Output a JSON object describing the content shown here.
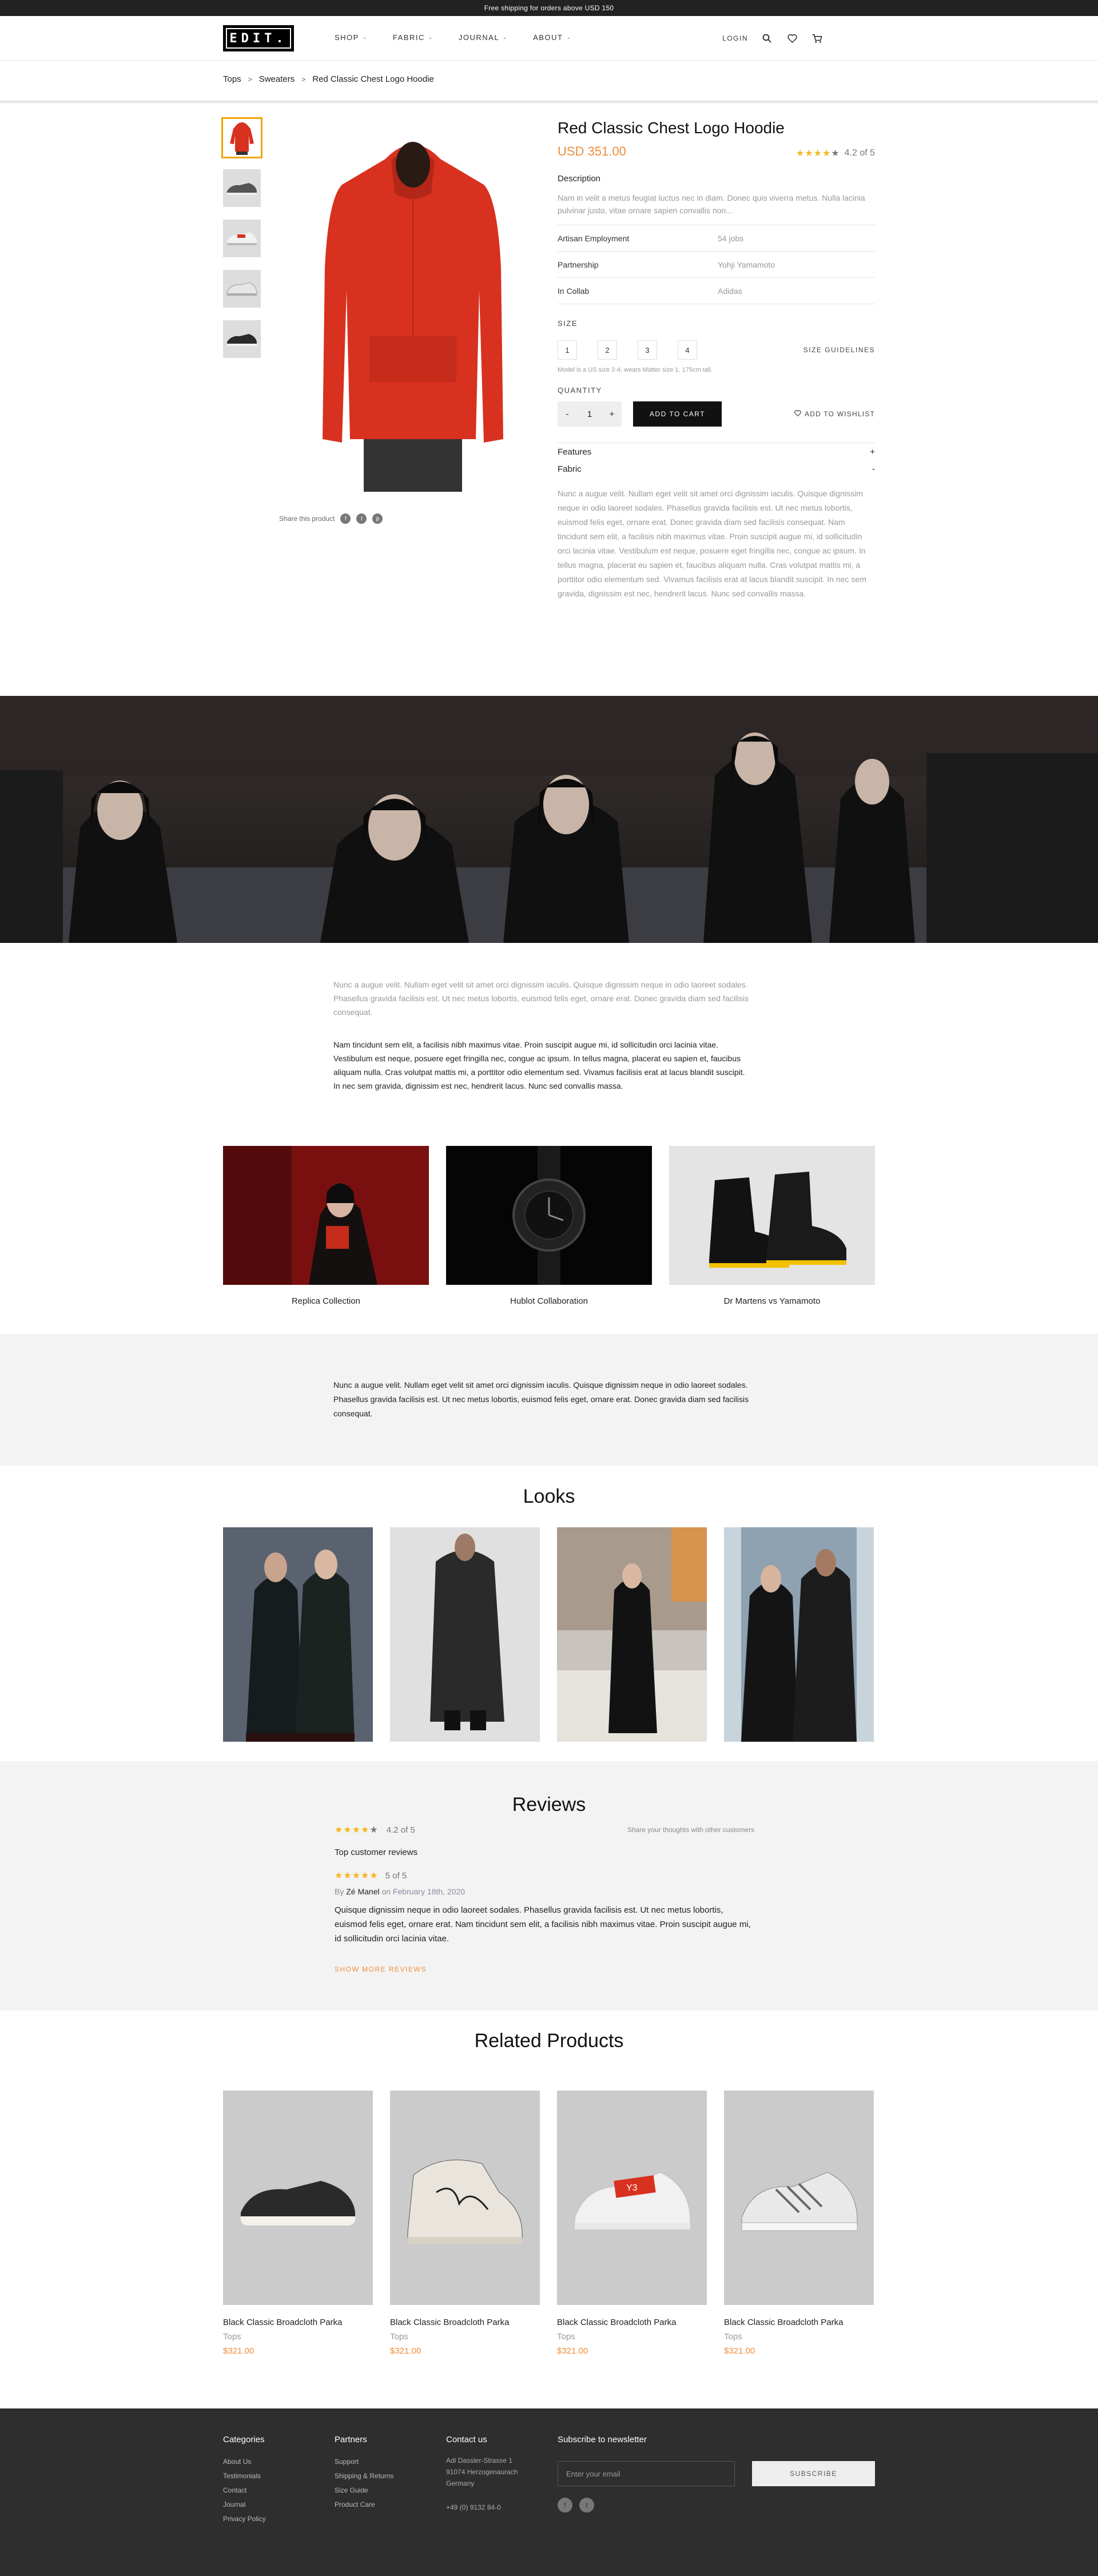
{
  "topbar": {
    "text": "Free shipping for orders above USD 150"
  },
  "header": {
    "logo": "EDIT.",
    "nav": [
      {
        "label": "SHOP"
      },
      {
        "label": "FABRIC"
      },
      {
        "label": "JOURNAL"
      },
      {
        "label": "ABOUT"
      }
    ],
    "login": "LOGIN",
    "icons": [
      "search-icon",
      "heart-icon",
      "cart-icon"
    ]
  },
  "breadcrumb": [
    "Tops",
    "Sweaters",
    "Red Classic Chest Logo Hoodie"
  ],
  "product": {
    "title": "Red Classic Chest Logo Hoodie",
    "price": "USD 351.00",
    "rating": 4.2,
    "rating_text": "4.2 of 5",
    "description_heading": "Description",
    "description": "Nam in velit a metus feugiat luctus nec in diam. Donec quis viverra metus. Nulla lacinia pulvinar justo, vitae ornare sapien convallis non...",
    "attributes": [
      {
        "key": "Artisan Employment",
        "value": "54 jobs"
      },
      {
        "key": "Partnership",
        "value": "Yohji Yamamoto"
      },
      {
        "key": "In Collab",
        "value": "Adidas"
      }
    ],
    "size_heading": "SIZE",
    "sizes": [
      "1",
      "2",
      "3",
      "4"
    ],
    "size_guide": "SIZE GUIDELINES",
    "model_note": "Model is a US size 2-4, wears Matter size 1. 175cm tall.",
    "quantity_heading": "QUANTITY",
    "quantity": "1",
    "minus": "-",
    "plus": "+",
    "add_to_cart": "ADD TO CART",
    "wishlist": "ADD TO WISHLIST",
    "accordion": [
      {
        "label": "Features",
        "sign": "+"
      },
      {
        "label": "Fabric",
        "sign": "-"
      }
    ],
    "fabric_text": "Nunc a augue velit. Nullam eget velit sit amet orci dignissim iaculis. Quisque dignissim neque in odio laoreet sodales. Phasellus gravida facilisis est. Ut nec metus lobortis, euismod felis eget, ornare erat. Donec gravida diam sed facilisis consequat. Nam tincidunt sem elit, a facilisis nibh maximus vitae. Proin suscipit augue mi, id sollicitudin orci lacinia vitae. Vestibulum est neque, posuere eget fringilla nec, congue ac ipsum. In tellus magna, placerat eu sapien et, faucibus aliquam nulla. Cras volutpat mattis mi, a porttitor odio elementum sed. Vivamus facilisis erat at lacus blandit suscipit. In nec sem gravida, dignissim est nec, hendrerit lacus. Nunc sed convallis massa.",
    "share_label": "Share this product",
    "share_icons": [
      "facebook-icon",
      "twitter-icon",
      "pinterest-icon"
    ]
  },
  "story": {
    "p1": "Nunc a augue velit. Nullam eget velit sit amet orci dignissim iaculis. Quisque dignissim neque in odio laoreet sodales. Phasellus gravida facilisis est. Ut nec metus lobortis, euismod felis eget, ornare erat. Donec gravida diam sed facilisis consequat.",
    "p2": "Nam tincidunt sem elit, a facilisis nibh maximus vitae. Proin suscipit augue mi, id sollicitudin orci lacinia vitae. Vestibulum est neque, posuere eget fringilla nec, congue ac ipsum. In tellus magna, placerat eu sapien et, faucibus aliquam nulla. Cras volutpat mattis mi, a porttitor odio elementum sed. Vivamus facilisis erat at lacus blandit suscipit. In nec sem gravida, dignissim est nec, hendrerit lacus. Nunc sed convallis massa."
  },
  "collections": [
    {
      "label": "Replica Collection"
    },
    {
      "label": "Hublot Collaboration"
    },
    {
      "label": "Dr Martens vs Yamamoto"
    }
  ],
  "grey_text": "Nunc a augue velit. Nullam eget velit sit amet orci dignissim iaculis. Quisque dignissim neque in odio laoreet sodales. Phasellus gravida facilisis est. Ut nec metus lobortis, euismod felis eget, ornare erat. Donec gravida diam sed facilisis consequat.",
  "looks": {
    "title": "Looks"
  },
  "reviews": {
    "title": "Reviews",
    "summary": "4.2 of 5",
    "share": "Share your thoughts with other customers",
    "top": "Top customer reviews",
    "item": {
      "rating_text": "5 of 5",
      "by": "By",
      "author": "Zé Manel",
      "on": "on",
      "date": "February 18th, 2020",
      "text": "Quisque dignissim neque in odio laoreet sodales. Phasellus gravida facilisis est. Ut nec metus lobortis, euismod felis eget, ornare erat. Nam tincidunt sem elit, a facilisis nibh maximus vitae. Proin suscipit augue mi, id sollicitudin orci lacinia vitae."
    },
    "more": "SHOW MORE REVIEWS"
  },
  "related": {
    "title": "Related Products",
    "items": [
      {
        "name": "Black Classic Broadcloth Parka",
        "category": "Tops",
        "price": "$321.00"
      },
      {
        "name": "Black Classic Broadcloth Parka",
        "category": "Tops",
        "price": "$321.00"
      },
      {
        "name": "Black Classic Broadcloth Parka",
        "category": "Tops",
        "price": "$321.00"
      },
      {
        "name": "Black Classic Broadcloth Parka",
        "category": "Tops",
        "price": "$321.00"
      }
    ]
  },
  "footer": {
    "categories": {
      "title": "Categories",
      "links": [
        "About Us",
        "Testimonials",
        "Contact",
        "Journal",
        "Privacy Policy"
      ]
    },
    "partners": {
      "title": "Partners",
      "links": [
        "Support",
        "Shipping & Returns",
        "Size Guide",
        "Product Care"
      ]
    },
    "contact": {
      "title": "Contact us",
      "address1": "Adl Dassler-Strasse 1",
      "address2": "91074 Herzogenaurach",
      "address3": "Germany",
      "phone": "+49 (0) 9132 84-0"
    },
    "newsletter": {
      "title": "Subscribe to newsletter",
      "placeholder": "Enter your email",
      "button": "SUBSCRIBE"
    }
  },
  "colors": {
    "accent": "#f08c3a",
    "star": "#f3b61f",
    "dark": "#2e2e2e"
  }
}
